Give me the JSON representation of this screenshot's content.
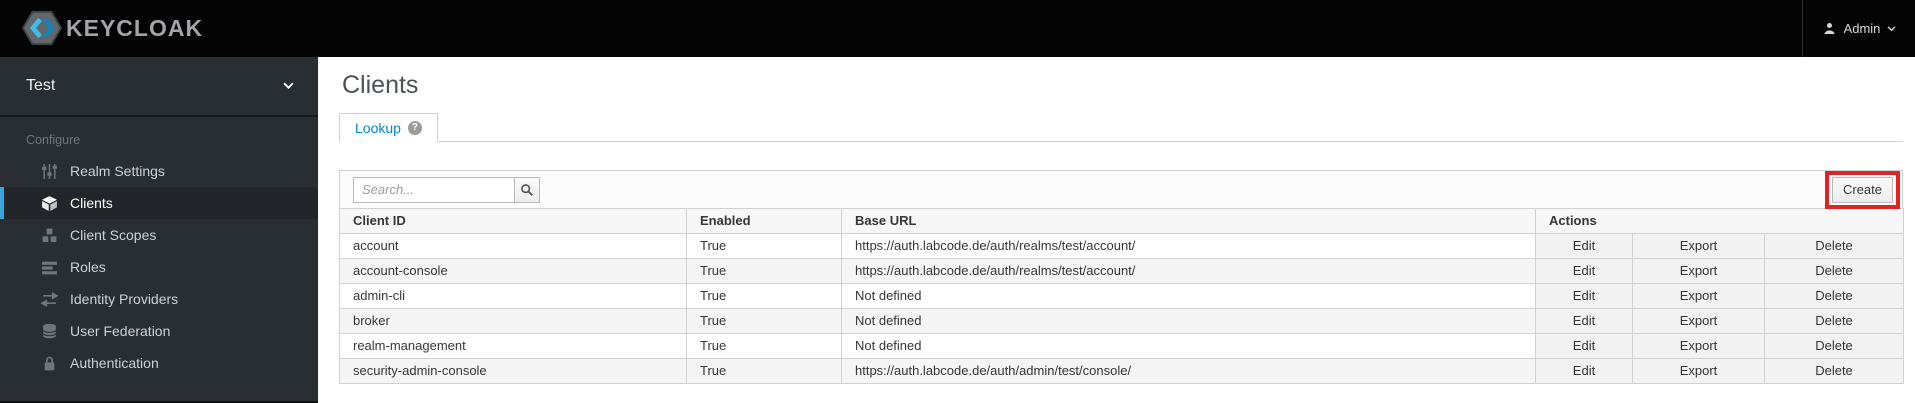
{
  "header": {
    "brand": "KEYCLOAK",
    "user": {
      "name": "Admin"
    }
  },
  "sidebar": {
    "realm_name": "Test",
    "section_label": "Configure",
    "items": [
      {
        "label": "Realm Settings",
        "icon": "sliders-icon",
        "active": false
      },
      {
        "label": "Clients",
        "icon": "cube-icon",
        "active": true
      },
      {
        "label": "Client Scopes",
        "icon": "cubes-icon",
        "active": false
      },
      {
        "label": "Roles",
        "icon": "list-bars-icon",
        "active": false
      },
      {
        "label": "Identity Providers",
        "icon": "exchange-arrows-icon",
        "active": false
      },
      {
        "label": "User Federation",
        "icon": "database-icon",
        "active": false
      },
      {
        "label": "Authentication",
        "icon": "lock-icon",
        "active": false
      }
    ]
  },
  "main": {
    "title": "Clients",
    "tabs": [
      {
        "label": "Lookup",
        "active": true,
        "help_glyph": "?"
      }
    ],
    "toolbar": {
      "search_placeholder": "Search...",
      "create_label": "Create"
    },
    "table": {
      "columns": [
        "Client ID",
        "Enabled",
        "Base URL",
        "Actions"
      ],
      "action_labels": [
        "Edit",
        "Export",
        "Delete"
      ],
      "rows": [
        {
          "client_id": "account",
          "enabled": "True",
          "base_url": "https://auth.labcode.de/auth/realms/test/account/"
        },
        {
          "client_id": "account-console",
          "enabled": "True",
          "base_url": "https://auth.labcode.de/auth/realms/test/account/"
        },
        {
          "client_id": "admin-cli",
          "enabled": "True",
          "base_url": "Not defined"
        },
        {
          "client_id": "broker",
          "enabled": "True",
          "base_url": "Not defined"
        },
        {
          "client_id": "realm-management",
          "enabled": "True",
          "base_url": "Not defined"
        },
        {
          "client_id": "security-admin-console",
          "enabled": "True",
          "base_url": "https://auth.labcode.de/auth/admin/test/console/"
        }
      ]
    }
  },
  "colors": {
    "navbar_bg": "#040404",
    "sidebar_bg": "#292e33",
    "active_indicator": "#39a5dc",
    "link": "#0088ce",
    "annotation": "#e0231f"
  }
}
